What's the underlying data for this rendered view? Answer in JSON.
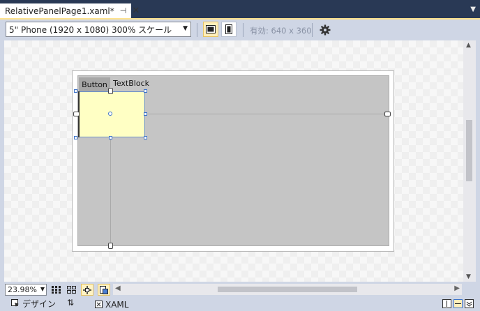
{
  "tab": {
    "title": "RelativePanelPage1.xaml*",
    "pin_glyph": "⊣",
    "close_glyph": "✕",
    "dropdown_glyph": "▼"
  },
  "toolbar": {
    "device_value": "5\" Phone (1920 x 1080) 300% スケール",
    "effective_label": "有効: 640 x 360",
    "landscape_icon": "landscape-icon",
    "portrait_icon": "portrait-icon",
    "settings_icon": "gear-icon"
  },
  "canvas": {
    "button_label": "Button",
    "textblock_label": "TextBlock",
    "selected_fill": "#ffffc4",
    "selection_color": "#3e74c9"
  },
  "statusbar": {
    "zoom_value": "23.98%"
  },
  "views": {
    "design_label": "デザイン",
    "swap_glyph": "⇅",
    "xaml_label": "XAML"
  },
  "colors": {
    "tab_strip": "#293955",
    "chrome": "#cfd6e5",
    "accent": "#ffe28d"
  }
}
